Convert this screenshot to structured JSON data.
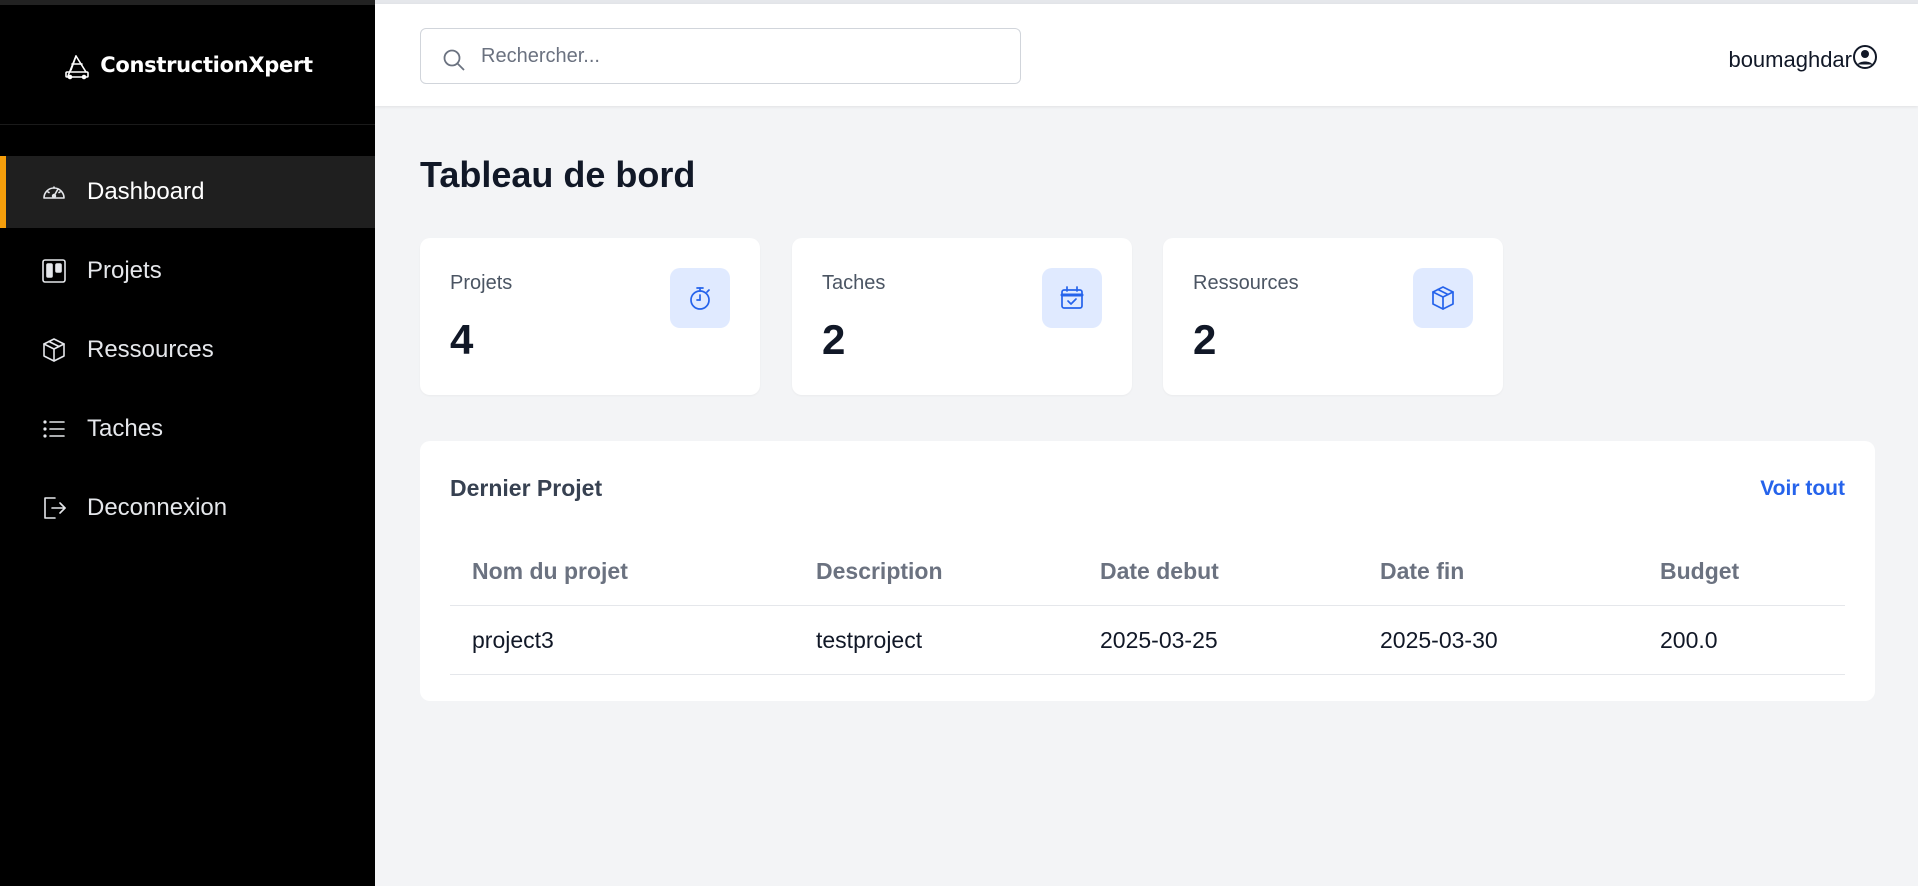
{
  "app": {
    "brand_name": "ConstructionXpert",
    "brand_icon": "crane-icon"
  },
  "sidebar": {
    "items": [
      {
        "label": "Dashboard",
        "icon": "gauge-icon",
        "active": true
      },
      {
        "label": "Projets",
        "icon": "kanban-icon",
        "active": false
      },
      {
        "label": "Ressources",
        "icon": "box-icon",
        "active": false
      },
      {
        "label": "Taches",
        "icon": "list-icon",
        "active": false
      },
      {
        "label": "Deconnexion",
        "icon": "logout-icon",
        "active": false
      }
    ]
  },
  "header": {
    "search_placeholder": "Rechercher...",
    "search_value": "",
    "username": "boumaghdar",
    "user_icon": "user-circle-icon"
  },
  "main": {
    "title": "Tableau de bord",
    "stats": [
      {
        "label": "Projets",
        "value": "4",
        "icon": "stopwatch-icon"
      },
      {
        "label": "Taches",
        "value": "2",
        "icon": "calendar-check-icon"
      },
      {
        "label": "Ressources",
        "value": "2",
        "icon": "box-icon"
      }
    ],
    "latest_projects": {
      "title": "Dernier Projet",
      "view_all_label": "Voir tout",
      "columns": [
        "Nom du projet",
        "Description",
        "Date debut",
        "Date fin",
        "Budget"
      ],
      "rows": [
        [
          "project3",
          "testproject",
          "2025-03-25",
          "2025-03-30",
          "200.0"
        ]
      ]
    }
  },
  "colors": {
    "sidebar_bg": "#000000",
    "active_accent": "#f59e0b",
    "link_blue": "#2563eb",
    "icon_tile_bg": "#e0eaff",
    "page_bg": "#f3f4f6"
  }
}
